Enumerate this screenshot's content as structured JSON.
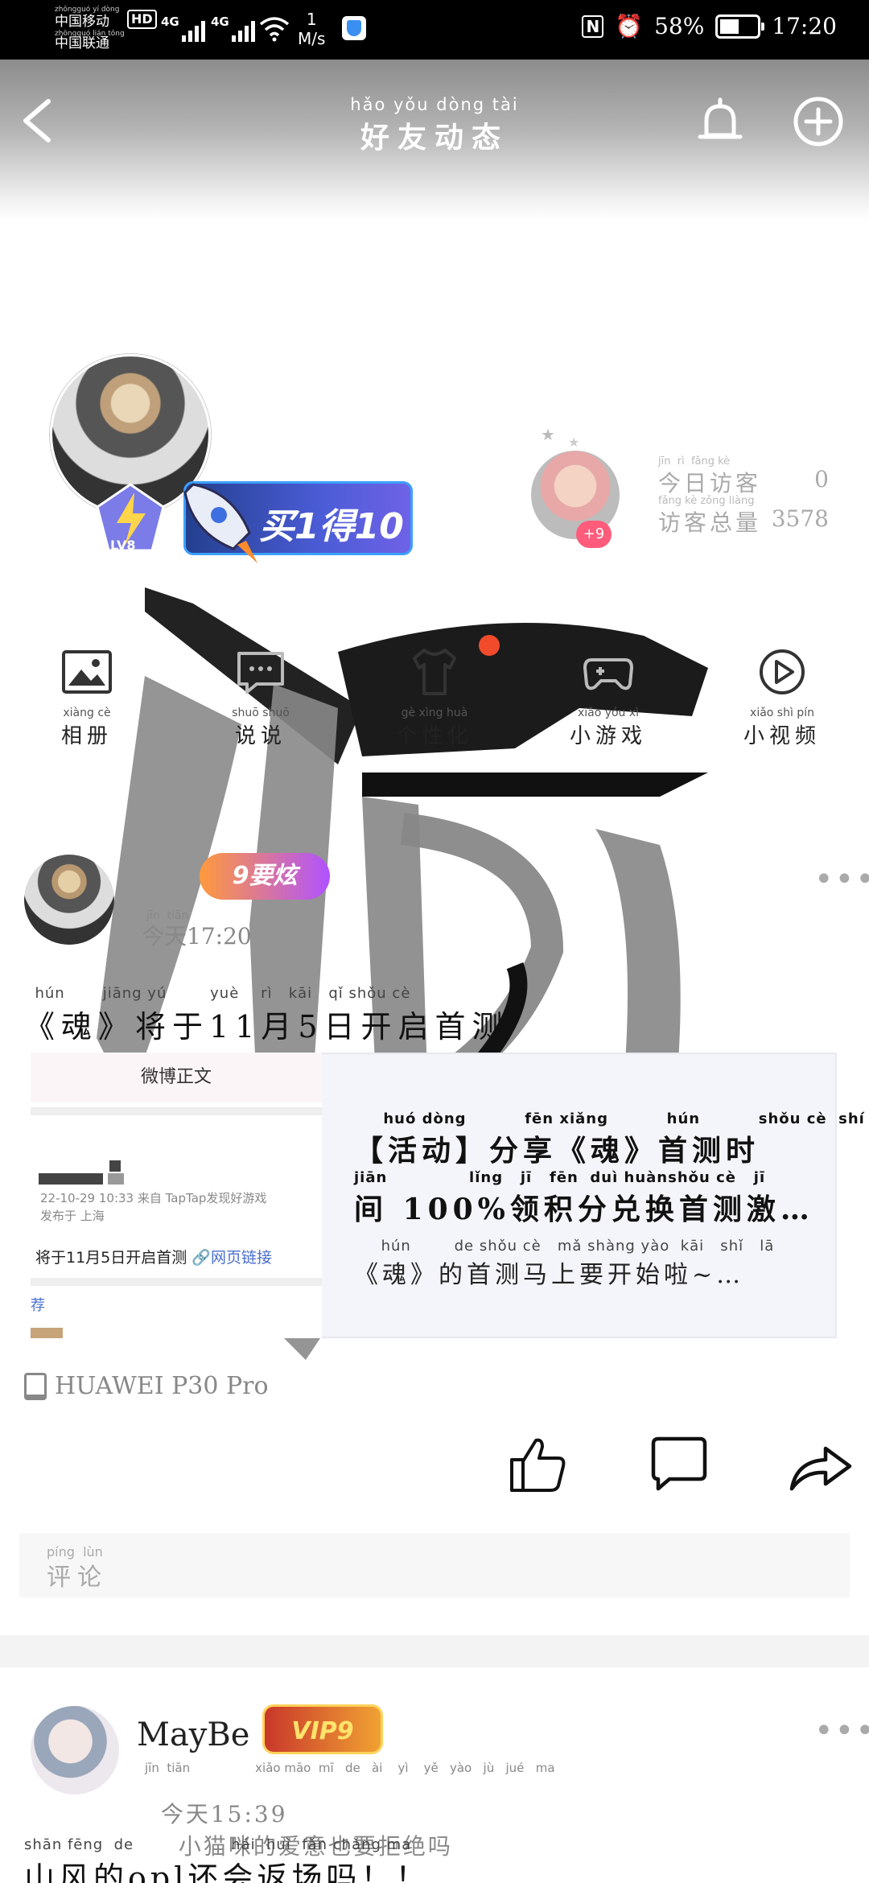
{
  "status_bar": {
    "carrier1_pinyin": "zhōngguó yí dòng",
    "carrier1": "中国移动",
    "carrier2_pinyin": "zhōngguó lián tōng",
    "carrier2": "中国联通",
    "hd": "HD",
    "net1": "4G",
    "net2": "4G",
    "speed_value": "1",
    "speed_unit": "M/s",
    "battery": "58%",
    "battery_level": 0.58,
    "time": "17:20"
  },
  "header": {
    "title_pinyin": "hǎo yǒu dòng tài",
    "title": "好友动态"
  },
  "profile": {
    "level": "LV8",
    "banner_text": "买1得10",
    "visitor_count_badge": "+9",
    "today_visitors_pinyin": "jīn  rì  fǎng kè",
    "today_visitors_label": "今日访客",
    "today_visitors_value": "0",
    "total_visitors_pinyin": "fǎng kè zǒng liàng",
    "total_visitors_label": "访客总量",
    "total_visitors_value": "3578"
  },
  "tabs": [
    {
      "pinyin": "xiàng cè",
      "label": "相册",
      "icon": "album-icon"
    },
    {
      "pinyin": "shuō shuō",
      "label": "说说",
      "icon": "chat-icon"
    },
    {
      "pinyin": "gè xìng huà",
      "label": "个性化",
      "icon": "tshirt-icon"
    },
    {
      "pinyin": "xiǎo yóu xì",
      "label": "小游戏",
      "icon": "gamepad-icon"
    },
    {
      "pinyin": "xiǎo shì pín",
      "label": "小视频",
      "icon": "video-play-icon"
    }
  ],
  "post1": {
    "badge": "9要炫",
    "time_pinyin": "jīn  tiān",
    "time": "今天17:20",
    "text_pinyin": "  hún       jiāng yú        yuè    rì   kāi   qǐ shǒu cè",
    "text": "《魂》将于11月5日开启首测",
    "card": {
      "thumb_header": "微博正文",
      "thumb_meta1": "22-10-29 10:33  来自 TapTap发现好游戏",
      "thumb_meta2": "发布于 上海",
      "thumb_line": "将于11月5日开启首测",
      "thumb_link": "🔗网页链接",
      "thumb_rec": "荐",
      "title_pinyin1": "     huó dòng          fēn xiǎng          hún          shǒu cè  shí",
      "title_line1": "【活动】分享《魂》首测时",
      "title_pinyin2": "jiān              lǐng   jī   fēn  duì huànshǒu cè   jī",
      "title_line2": "间 100%领积分兑换首测激…",
      "sub_pinyin": "     hún        de shǒu cè   mǎ shàng yào  kāi   shǐ   lā",
      "sub": "《魂》的首测马上要开始啦~…"
    },
    "device": "HUAWEI P30 Pro",
    "comment_pinyin": "píng  lùn",
    "comment_placeholder": "评论"
  },
  "post2": {
    "name": "MayBe",
    "vip": "VIP9",
    "meta_pinyin": "jīn  tiān                 xiǎo māo  mī   de   ài    yì    yě   yào   jù   jué   ma",
    "time": "今天15:39",
    "mood": "小猫咪的爱意也要拒绝吗",
    "text_pinyin": "shān fēng  de                  hái  huì  fǎn chǎng ma",
    "text": "山风的opl还会返场吗！！"
  },
  "colors": {
    "accent_red": "#f24b2b",
    "badge_pink": "#ff5b7b",
    "link_blue": "#4a6fd0",
    "status_bg": "#000000"
  }
}
